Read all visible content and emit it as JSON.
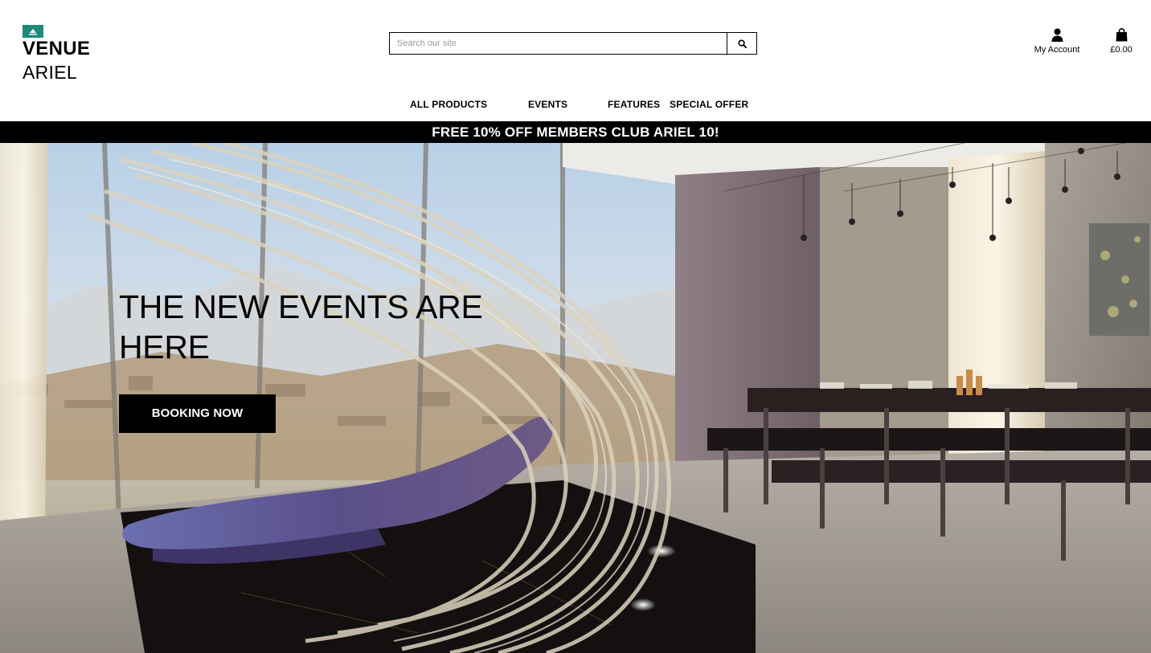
{
  "brand": {
    "line1": "VENUE",
    "line2": "ARIEL",
    "accent_color": "#1f8a7a"
  },
  "search": {
    "placeholder": "Search our site",
    "value": ""
  },
  "account": {
    "label": "My Account",
    "icon": "user-icon"
  },
  "cart": {
    "label": "£0.00",
    "icon": "shopping-bag-icon"
  },
  "nav": {
    "items": [
      {
        "label": "ALL PRODUCTS"
      },
      {
        "label": "EVENTS"
      },
      {
        "label": "FEATURES"
      },
      {
        "label": "SPECIAL OFFER"
      }
    ]
  },
  "promo": {
    "text": "FREE 10% OFF MEMBERS CLUB ARIEL 10!",
    "bg_color": "#000000"
  },
  "hero": {
    "title": "THE NEW EVENTS ARE HERE",
    "button_label": "BOOKING NOW"
  }
}
